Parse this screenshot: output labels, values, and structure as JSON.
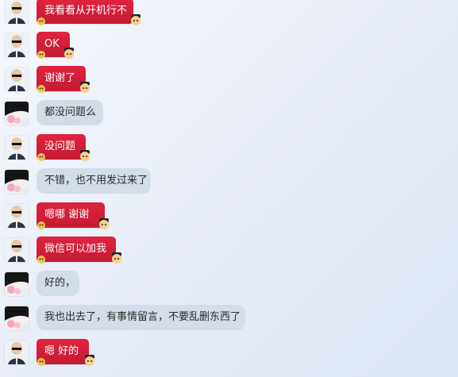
{
  "messages": [
    {
      "sender": "me",
      "avatar": "bald-man-sunglasses-avatar",
      "text": "我看看从开机行不"
    },
    {
      "sender": "me",
      "avatar": "bald-man-sunglasses-avatar",
      "text": "OK"
    },
    {
      "sender": "me",
      "avatar": "bald-man-sunglasses-avatar",
      "text": "谢谢了"
    },
    {
      "sender": "other",
      "avatar": "flower-bird-avatar",
      "text": "都没问题么"
    },
    {
      "sender": "me",
      "avatar": "bald-man-sunglasses-avatar",
      "text": "没问题"
    },
    {
      "sender": "other",
      "avatar": "flower-bird-avatar",
      "text": "不错，也不用发过来了"
    },
    {
      "sender": "me",
      "avatar": "bald-man-sunglasses-avatar",
      "text": "嗯哪  谢谢"
    },
    {
      "sender": "me",
      "avatar": "bald-man-sunglasses-avatar",
      "text": "微信可以加我"
    },
    {
      "sender": "other",
      "avatar": "flower-bird-avatar",
      "text": "好的，"
    },
    {
      "sender": "other",
      "avatar": "flower-bird-avatar",
      "text": "我也出去了，有事情留言，不要乱删东西了"
    },
    {
      "sender": "me",
      "avatar": "bald-man-sunglasses-avatar",
      "text": "嗯 好的"
    }
  ],
  "colors": {
    "my_bubble": "#d81f3a",
    "other_bubble": "#d3dde8",
    "background": "#e9eef8"
  }
}
